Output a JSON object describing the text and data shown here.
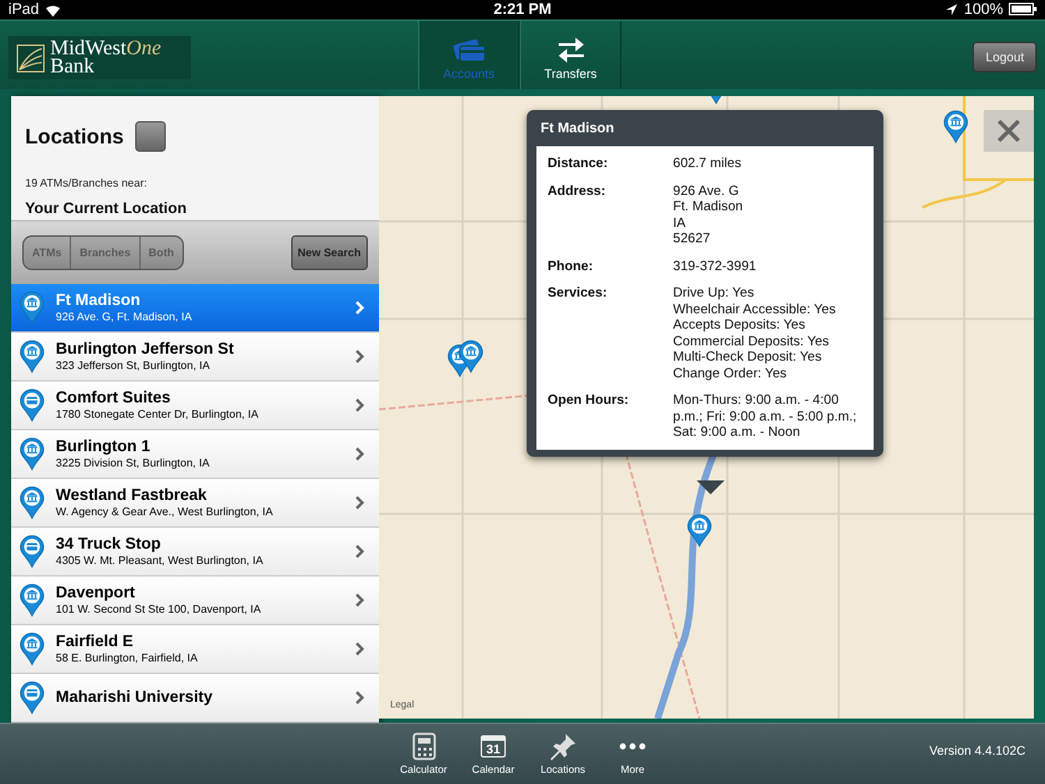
{
  "status_bar": {
    "device": "iPad",
    "time": "2:21 PM",
    "battery": "100%"
  },
  "header": {
    "logo": {
      "name_start": "MidWest",
      "name_end": "One",
      "line_2": "Bank"
    },
    "tabs": [
      {
        "label": "Accounts",
        "kind": "card",
        "selected": true
      },
      {
        "label": "Transfers",
        "kind": "arrows",
        "selected": false
      }
    ],
    "logout": "Logout"
  },
  "locations": {
    "title": "Locations",
    "count_text": "19 ATMs/Branches near:",
    "near": "Your Current Location",
    "filters": [
      {
        "label": "ATMs",
        "selected": false
      },
      {
        "label": "Branches",
        "selected": false
      },
      {
        "label": "Both",
        "selected": false
      }
    ],
    "new_search": "New Search",
    "rows": [
      {
        "name": "Ft Madison",
        "address": "926 Ave. G, Ft. Madison, IA",
        "kind": "branch",
        "selected": true
      },
      {
        "name": "Burlington Jefferson St",
        "address": "323 Jefferson St, Burlington, IA",
        "kind": "branch",
        "selected": false
      },
      {
        "name": "Comfort Suites",
        "address": "1780 Stonegate Center Dr, Burlington, IA",
        "kind": "atm",
        "selected": false
      },
      {
        "name": "Burlington 1",
        "address": "3225 Division St, Burlington, IA",
        "kind": "branch",
        "selected": false
      },
      {
        "name": "Westland Fastbreak",
        "address": "W. Agency & Gear Ave., West Burlington, IA",
        "kind": "branch",
        "selected": false
      },
      {
        "name": "34 Truck Stop",
        "address": "4305 W. Mt. Pleasant, West Burlington, IA",
        "kind": "atm",
        "selected": false
      },
      {
        "name": "Davenport",
        "address": "101 W. Second St Ste 100, Davenport, IA",
        "kind": "branch",
        "selected": false
      },
      {
        "name": "Fairfield E",
        "address": "58 E. Burlington, Fairfield, IA",
        "kind": "branch",
        "selected": false
      },
      {
        "name": "Maharishi University",
        "kind": "atm",
        "selected": false
      }
    ]
  },
  "map": {
    "popup": {
      "title": "Ft Madison",
      "fields": [
        {
          "label": "Distance:",
          "lines": [
            "602.7 miles"
          ]
        },
        {
          "label": "Address:",
          "lines": [
            "926 Ave. G",
            "Ft. Madison",
            "IA",
            "52627"
          ]
        },
        {
          "label": "Phone:",
          "lines": [
            "319-372-3991"
          ]
        },
        {
          "label": "Services:",
          "lines": [
            "Drive Up: Yes",
            "Wheelchair Accessible: Yes",
            "Accepts Deposits: Yes",
            "Commercial Deposits: Yes",
            "Multi-Check Deposit: Yes",
            "Change Order: Yes"
          ]
        },
        {
          "label": "Open Hours:",
          "lines": [
            "Mon-Thurs: 9:00 a.m. - 4:00 p.m.; Fri: 9:00 a.m. - 5:00 p.m.; Sat: 9:00 a.m. - Noon"
          ]
        }
      ]
    },
    "legal": "Legal"
  },
  "bottom_bar": {
    "items": [
      {
        "label": "Calculator",
        "kind": "calculator"
      },
      {
        "label": "Calendar",
        "kind": "calendar",
        "icon_text": "31"
      },
      {
        "label": "Locations",
        "kind": "pushpin"
      },
      {
        "label": "More",
        "kind": "dots"
      }
    ],
    "version": "Version 4.4.102C"
  }
}
